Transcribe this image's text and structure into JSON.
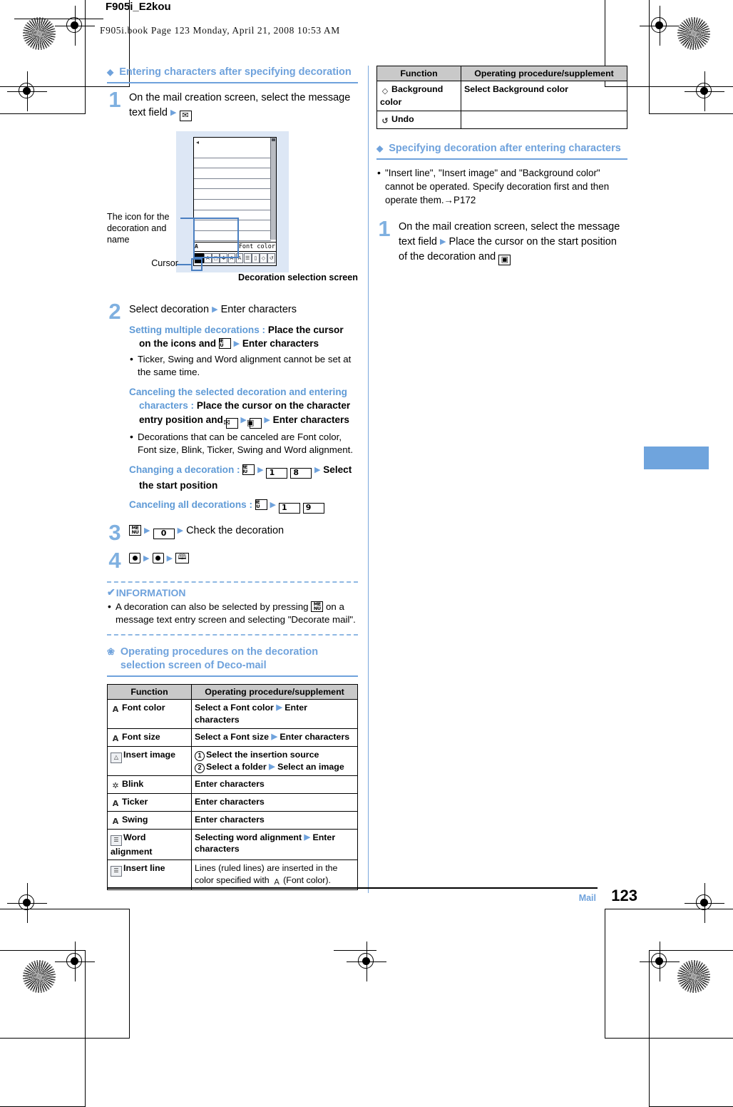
{
  "header": {
    "title": "F905i_E2kou",
    "bookline": "F905i.book  Page 123  Monday, April 21, 2008  10:53 AM"
  },
  "left": {
    "heading1": "Entering characters after specifying decoration",
    "step1": {
      "num": "1",
      "text_a": "On the mail creation screen, select the message text field",
      "key1": "mail-key"
    },
    "figure": {
      "label_icon": "The icon for the decoration and name",
      "label_cursor": "Cursor",
      "caption": "Decoration selection screen",
      "screen_status_left": "A",
      "screen_status_right": "Font color",
      "toolbar_icons": [
        "selected-color-swatch",
        "font-size-icon",
        "insert-image-icon",
        "blink-icon",
        "ticker-icon",
        "swing-icon",
        "word-alignment-icon",
        "insert-line-icon",
        "background-color-icon",
        "undo-icon"
      ]
    },
    "step2": {
      "num": "2",
      "text_a": "Select decoration",
      "text_b": "Enter characters",
      "sub1_label": "Setting multiple decorations :",
      "sub1_a": "Place the cursor on the icons and",
      "sub1_b": "Enter characters",
      "sub1_bullet": "Ticker, Swing and Word alignment cannot be set at the same time.",
      "sub2_label": "Canceling the selected decoration and entering characters :",
      "sub2_a": "Place the cursor on the character entry position and",
      "sub2_b": "Enter characters",
      "sub2_bullet": "Decorations that can be canceled are Font color, Font size, Blink, Ticker, Swing and Word alignment.",
      "sub3_label": "Changing a decoration :",
      "sub3_key1": "1",
      "sub3_key2": "8",
      "sub3_a": "Select the start position",
      "sub4_label": "Canceling all decorations :",
      "sub4_key1": "1",
      "sub4_key2": "9"
    },
    "step3": {
      "num": "3",
      "key_num": "0",
      "text_a": "Check the decoration"
    },
    "step4": {
      "num": "4"
    },
    "information": {
      "title": "INFORMATION",
      "items": [
        "A decoration can also be selected by pressing   on a message text entry screen and selecting \"Decorate mail\"."
      ],
      "item1_pre": "A decoration can also be selected by pressing",
      "item1_post": "on a message text entry screen and selecting \"Decorate mail\"."
    },
    "heading2": "Operating procedures on the decoration selection screen of Deco-mail",
    "table": {
      "headers": [
        "Function",
        "Operating procedure/supplement"
      ],
      "rows": [
        {
          "icon": "font-color-icon",
          "function": "Font color",
          "proc_parts": [
            "Select a Font color",
            "Enter characters"
          ],
          "bold": true
        },
        {
          "icon": "font-size-icon",
          "function": "Font size",
          "proc_parts": [
            "Select a Font size",
            "Enter characters"
          ],
          "bold": true
        },
        {
          "icon": "insert-image-icon",
          "function": "Insert image",
          "proc_line1": "Select the insertion source",
          "proc_line2_parts": [
            "Select a folder",
            "Select an image"
          ],
          "bold": true
        },
        {
          "icon": "blink-icon",
          "function": "Blink",
          "proc": "Enter characters",
          "bold": true
        },
        {
          "icon": "ticker-icon",
          "function": "Ticker",
          "proc": "Enter characters",
          "bold": true
        },
        {
          "icon": "swing-icon",
          "function": "Swing",
          "proc": "Enter characters",
          "bold": true
        },
        {
          "icon": "word-alignment-icon",
          "function": "Word alignment",
          "proc_parts": [
            "Selecting word alignment",
            "Enter characters"
          ],
          "bold": true
        },
        {
          "icon": "insert-line-icon",
          "function": "Insert line",
          "proc_plain_pre": "Lines (ruled lines) are inserted in the color specified with",
          "proc_plain_post": "(Font color).",
          "bold": false
        }
      ]
    }
  },
  "right": {
    "table": {
      "headers": [
        "Function",
        "Operating procedure/supplement"
      ],
      "rows": [
        {
          "icon": "background-color-icon",
          "function": "Background color",
          "proc": "Select Background color"
        },
        {
          "icon": "undo-icon",
          "function": "Undo",
          "proc": ""
        }
      ]
    },
    "heading1": "Specifying decoration after entering characters",
    "note1": "\"Insert line\", \"Insert image\" and \"Background color\" cannot be operated. Specify decoration first and then operate them.→P172",
    "step1": {
      "num": "1",
      "text_a": "On the mail creation screen, select the message text field",
      "text_b": "Place the cursor on the start position of the decoration and"
    }
  },
  "footer": {
    "chapter": "Mail",
    "page": "123"
  },
  "colors": {
    "accent_blue": "#6fa2dc",
    "figure_bg": "#dde7f5",
    "callout_blue": "#4a7fc1",
    "table_header_gray": "#c9c9c9"
  }
}
